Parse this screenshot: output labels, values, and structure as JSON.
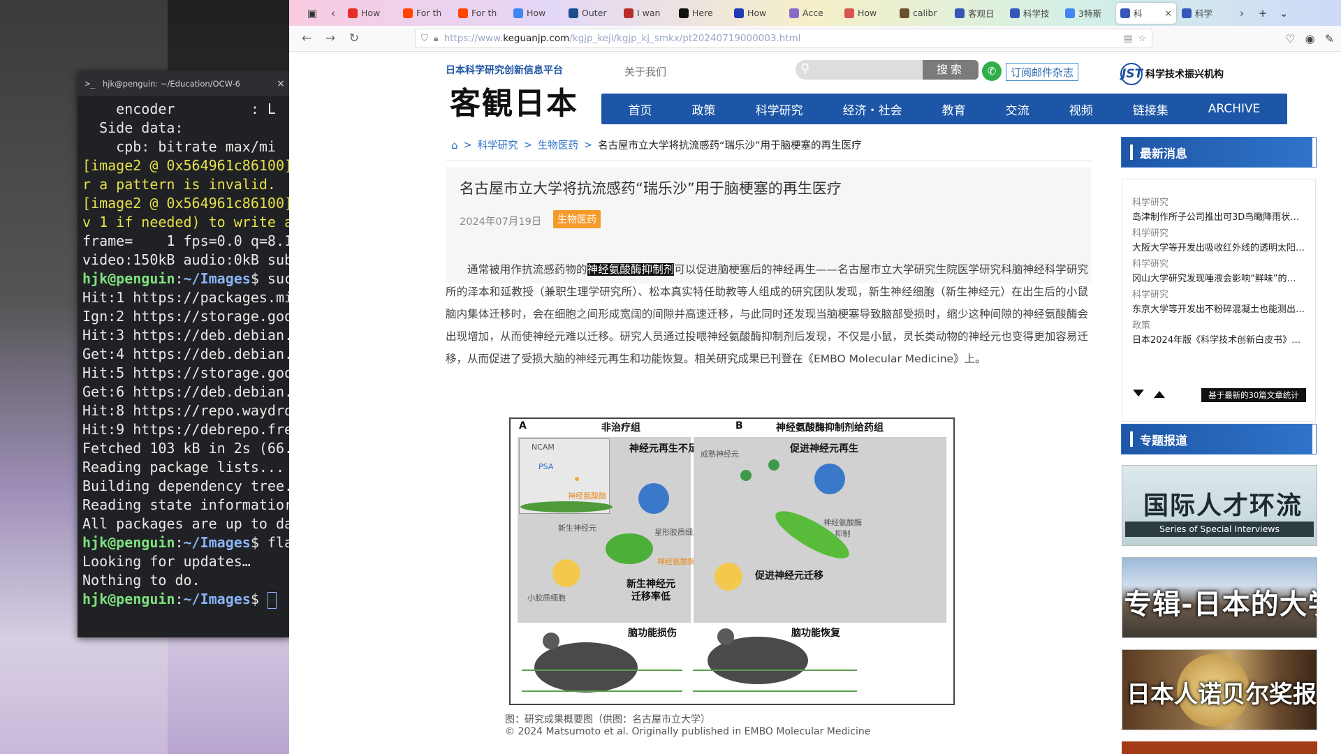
{
  "terminal": {
    "title": "hjk@penguin: ~/Education/OCW-6",
    "close": "×",
    "prompt_icon": ">_",
    "lines": [
      {
        "text": "    encoder         : L",
        "cls": ""
      },
      {
        "text": "  Side data:",
        "cls": ""
      },
      {
        "text": "    cpb: bitrate max/mi",
        "cls": ""
      },
      {
        "text": "[image2 @ 0x564961c86100]",
        "cls": "c-y"
      },
      {
        "text": "r a pattern is invalid.",
        "cls": "c-y"
      },
      {
        "text": "[image2 @ 0x564961c86100]",
        "cls": "c-y"
      },
      {
        "text": "v 1 if needed) to write a",
        "cls": "c-y"
      },
      {
        "text": "frame=    1 fps=0.0 q=8.1",
        "cls": ""
      },
      {
        "text": "video:150kB audio:0kB sub",
        "cls": ""
      },
      {
        "prompt": true,
        "user": "hjk@penguin",
        "path": "~/Images",
        "cmd": "$ suc"
      },
      {
        "text": "Hit:1 https://packages.mi",
        "cls": ""
      },
      {
        "text": "Ign:2 https://storage.goo",
        "cls": ""
      },
      {
        "text": "Hit:3 https://deb.debian.",
        "cls": ""
      },
      {
        "text": "Get:4 https://deb.debian.",
        "cls": ""
      },
      {
        "text": "Hit:5 https://storage.goo",
        "cls": ""
      },
      {
        "text": "Get:6 https://deb.debian.",
        "cls": ""
      },
      {
        "text": "Hit:8 https://repo.waydro",
        "cls": ""
      },
      {
        "text": "Hit:9 https://debrepo.fre",
        "cls": ""
      },
      {
        "text": "Fetched 103 kB in 2s (66.",
        "cls": ""
      },
      {
        "text": "Reading package lists...",
        "cls": ""
      },
      {
        "text": "Building dependency tree.",
        "cls": ""
      },
      {
        "text": "Reading state informatior",
        "cls": ""
      },
      {
        "text": "All packages are up to da",
        "cls": ""
      },
      {
        "prompt": true,
        "user": "hjk@penguin",
        "path": "~/Images",
        "cmd": "$ fla"
      },
      {
        "text": "Looking for updates…",
        "cls": ""
      },
      {
        "text": "",
        "cls": ""
      },
      {
        "text": "Nothing to do.",
        "cls": ""
      },
      {
        "prompt": true,
        "user": "hjk@penguin",
        "path": "~/Images",
        "cmd": "$ ",
        "cursor": true
      }
    ]
  },
  "browser": {
    "tabs": [
      {
        "label": "How",
        "color": "#e52d27",
        "icon": "youtube-icon"
      },
      {
        "label": "For th",
        "color": "#ff4500",
        "icon": "reddit-icon"
      },
      {
        "label": "For th",
        "color": "#ff4500",
        "icon": "reddit-icon"
      },
      {
        "label": "How",
        "color": "#4285f4",
        "icon": "google-icon"
      },
      {
        "label": "Outer",
        "color": "#1a4f8a",
        "icon": "site-icon"
      },
      {
        "label": "I wan",
        "color": "#b92b27",
        "icon": "quora-icon"
      },
      {
        "label": "Here",
        "color": "#111111",
        "icon": "site-icon"
      },
      {
        "label": "How",
        "color": "#1e3cb4",
        "icon": "site-icon"
      },
      {
        "label": "Acce",
        "color": "#8a6cc8",
        "icon": "site-icon"
      },
      {
        "label": "How",
        "color": "#d9534f",
        "icon": "site-icon"
      },
      {
        "label": "calibr",
        "color": "#6b4e2a",
        "icon": "site-icon"
      },
      {
        "label": "客观日",
        "color": "#3456b8",
        "icon": "site-icon"
      },
      {
        "label": "科学技",
        "color": "#3456b8",
        "icon": "site-icon"
      },
      {
        "label": "3特斯",
        "color": "#4285f4",
        "icon": "google-icon"
      },
      {
        "label": "科",
        "color": "#3456b8",
        "icon": "site-icon",
        "active": true,
        "close": "×"
      },
      {
        "label": "科学",
        "color": "#3456b8",
        "icon": "site-icon"
      }
    ],
    "url_prefix": "https://www.",
    "url_domain": "keguanjp.com",
    "url_path": "/kgjp_keji/kgjp_kj_smkx/pt20240719000003.html"
  },
  "site": {
    "tag": "日本科学研究创新信息平台",
    "logo": "客観日本",
    "about": "关于我们",
    "search_btn": "搜索",
    "subscribe": "订阅邮件杂志",
    "jst_mark": "JST",
    "jst_name": "科学技术振兴机构",
    "nav": [
      "首页",
      "政策",
      "科学研究",
      "经济・社会",
      "教育",
      "交流",
      "视频",
      "链接集",
      "ARCHIVE"
    ]
  },
  "breadcrumb": {
    "items": [
      "科学研究",
      "生物医药"
    ],
    "current": "名古屋市立大学将抗流感药“瑞乐沙”用于脑梗塞的再生医疗",
    "sep": ">"
  },
  "article": {
    "title": "名古屋市立大学将抗流感药“瑞乐沙”用于脑梗塞的再生医疗",
    "date": "2024年07月19日",
    "category": "生物医药",
    "body_pre": "通常被用作抗流感药物的",
    "body_highlight": "神经氨酸酶抑制剂",
    "body_post": "可以促进脑梗塞后的神经再生——名古屋市立大学研究生院医学研究科脑神经科学研究所的泽本和延教授（兼职生理学研究所）、松本真实特任助教等人组成的研究团队发现，新生神经细胞（新生神经元）在出生后的小鼠脑内集体迁移时，会在细胞之间形成宽阔的间隙并高速迁移，与此同时还发现当脑梗塞导致脑部受损时，缩少这种间隙的神经氨酸酶会出现增加，从而使神经元难以迁移。研究人员通过投喂神经氨酸酶抑制剂后发现，不仅是小鼠，灵长类动物的神经元也变得更加容易迁移，从而促进了受损大脑的神经元再生和功能恢复。相关研究成果已刊登在《EMBO Molecular Medicine》上。",
    "figure": {
      "label_a": "A",
      "label_b": "B",
      "title_a": "非治疗组",
      "title_b": "神经氨酸酶抑制剂给药组",
      "a_insufficient": "神经元再生不足",
      "b_promote": "促进神经元再生",
      "ncam": "NCAM",
      "psa": "PSA",
      "neuraminidase": "神经氨酸酶",
      "new_neuron": "新生神经元",
      "astrocyte": "星形胶质细胞",
      "neuraminidase2": "神经氨酸酶",
      "microglia": "小胶质细胞",
      "migration_low": "新生神经元\n迁移率低",
      "mature_neuron": "成熟神经元",
      "inhibit": "神经氨酸酶\n抑制",
      "promote_migration": "促进神经元迁移",
      "damage": "脑功能损伤",
      "recovery": "脑功能恢复"
    },
    "caption1": "图：研究成果概要图（供图：名古屋市立大学）",
    "caption2": "© 2024 Matsumoto et al. Originally published in EMBO Molecular Medicine"
  },
  "sidebar": {
    "news_title": "最新消息",
    "news": [
      {
        "cat": "科学研究",
        "title": "岛津制作所子公司推出可3D鸟瞰降雨状况…"
      },
      {
        "cat": "科学研究",
        "title": "大阪大学等开发出吸收红外线的透明太阳…"
      },
      {
        "cat": "科学研究",
        "title": "冈山大学研究发现唾液会影响“鲜味”的…"
      },
      {
        "cat": "科学研究",
        "title": "东京大学等开发出不粉碎混凝土也能测出C…"
      },
      {
        "cat": "政策",
        "title": "日本2024年版《科学技术创新白皮书》发…"
      }
    ],
    "news_stat": "基于最新的30篇文章统计",
    "topic_title": "专题报道",
    "banner1": "国际人才环流",
    "banner1_sub": "Series of Special Interviews",
    "banner2": "专辑-日本的大学",
    "banner3": "日本人诺贝尔奖报道"
  }
}
